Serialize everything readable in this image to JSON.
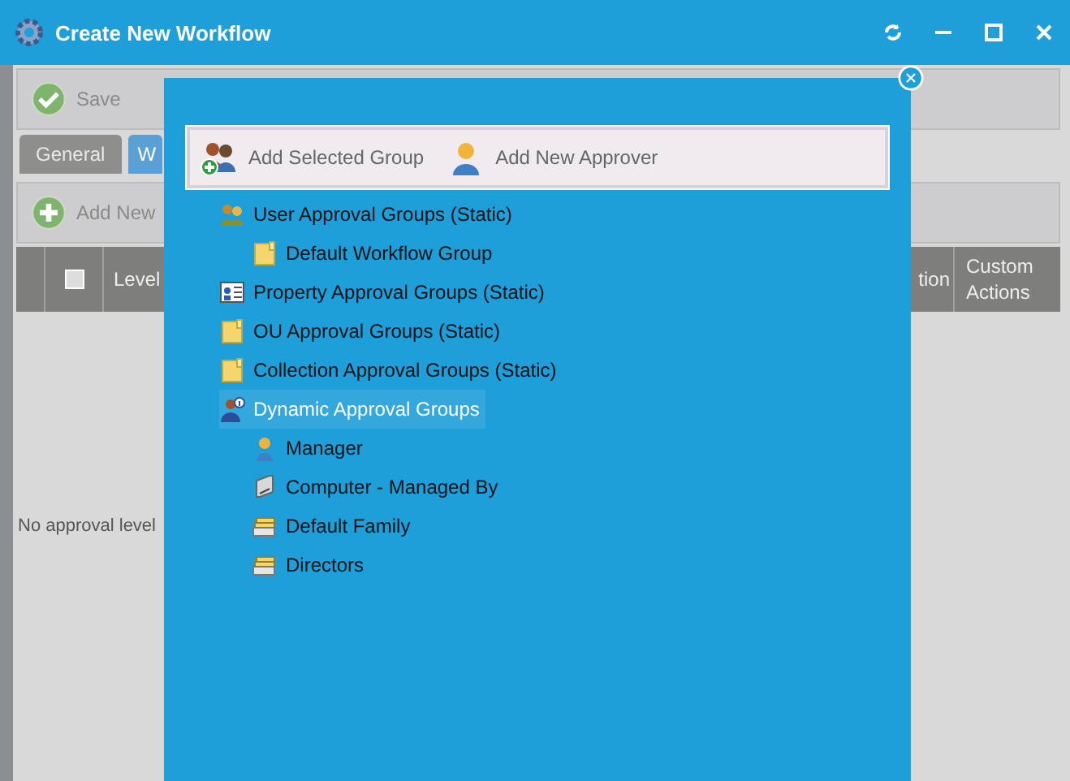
{
  "window": {
    "title": "Create New Workflow"
  },
  "toolbar": {
    "save": "Save"
  },
  "tabs": [
    {
      "label": "General",
      "selected": false
    },
    {
      "label": "W",
      "selected": true
    }
  ],
  "sub_toolbar": {
    "add": "Add New"
  },
  "table": {
    "columns": [
      {
        "kind": "blank"
      },
      {
        "kind": "checkbox",
        "checked": false
      },
      {
        "label": "Level",
        "kind": "text"
      },
      {
        "label": "tion",
        "kind": "right"
      },
      {
        "label": "Custom Actions",
        "kind": "text"
      }
    ],
    "empty_message": "No approval level"
  },
  "popup": {
    "actions": [
      "Add Selected Group",
      "Add New Approver"
    ],
    "tree": [
      {
        "label": "User Approval Groups (Static)",
        "kind": "users",
        "selected": false,
        "children": [
          {
            "label": "Default Workflow Group",
            "kind": "folder",
            "selected": false
          }
        ]
      },
      {
        "label": "Property Approval Groups (Static)",
        "kind": "property",
        "selected": false
      },
      {
        "label": "OU Approval Groups (Static)",
        "kind": "folder",
        "selected": false
      },
      {
        "label": "Collection Approval Groups (Static)",
        "kind": "folder",
        "selected": false
      },
      {
        "label": "Dynamic Approval Groups",
        "kind": "dynamic",
        "selected": true,
        "children": [
          {
            "label": "Manager",
            "kind": "person",
            "selected": false
          },
          {
            "label": "Computer - Managed By",
            "kind": "computer",
            "selected": false
          },
          {
            "label": "Default Family",
            "kind": "group",
            "selected": false
          },
          {
            "label": "Directors",
            "kind": "group",
            "selected": false
          }
        ]
      }
    ]
  }
}
